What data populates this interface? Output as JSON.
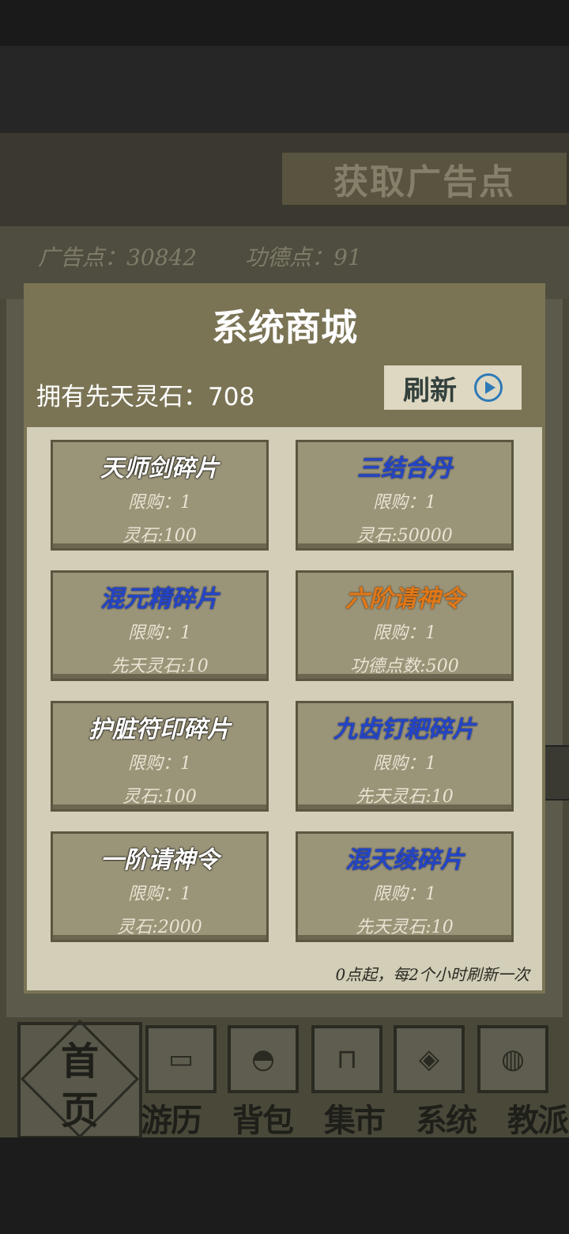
{
  "background": {
    "ad_button_label": "获取广告点",
    "ad_points": "广告点：30842",
    "merit_points": "功德点：91"
  },
  "shop": {
    "title": "系统商城",
    "stone_label": "拥有先天灵石：708",
    "refresh_label": "刷新",
    "items": [
      {
        "name": "天师剑碎片",
        "color": "#ffffff",
        "limit": "限购：1",
        "price": "灵石:100"
      },
      {
        "name": "三结合丹",
        "color": "#2445c6",
        "limit": "限购：1",
        "price": "灵石:50000"
      },
      {
        "name": "混元精碎片",
        "color": "#2445c6",
        "limit": "限购：1",
        "price": "先天灵石:10"
      },
      {
        "name": "六阶请神令",
        "color": "#e07818",
        "limit": "限购：1",
        "price": "功德点数:500"
      },
      {
        "name": "护脏符印碎片",
        "color": "#ffffff",
        "limit": "限购：1",
        "price": "灵石:100"
      },
      {
        "name": "九齿钉耙碎片",
        "color": "#2445c6",
        "limit": "限购：1",
        "price": "先天灵石:10"
      },
      {
        "name": "一阶请神令",
        "color": "#ffffff",
        "limit": "限购：1",
        "price": "灵石:2000"
      },
      {
        "name": "混天绫碎片",
        "color": "#2445c6",
        "limit": "限购：1",
        "price": "先天灵石:10"
      }
    ],
    "note": "0点起，每2个小时刷新一次"
  },
  "nav": {
    "home": [
      "首",
      "页"
    ],
    "tabs": [
      "游历",
      "背包",
      "集市",
      "系统",
      "教派"
    ]
  }
}
